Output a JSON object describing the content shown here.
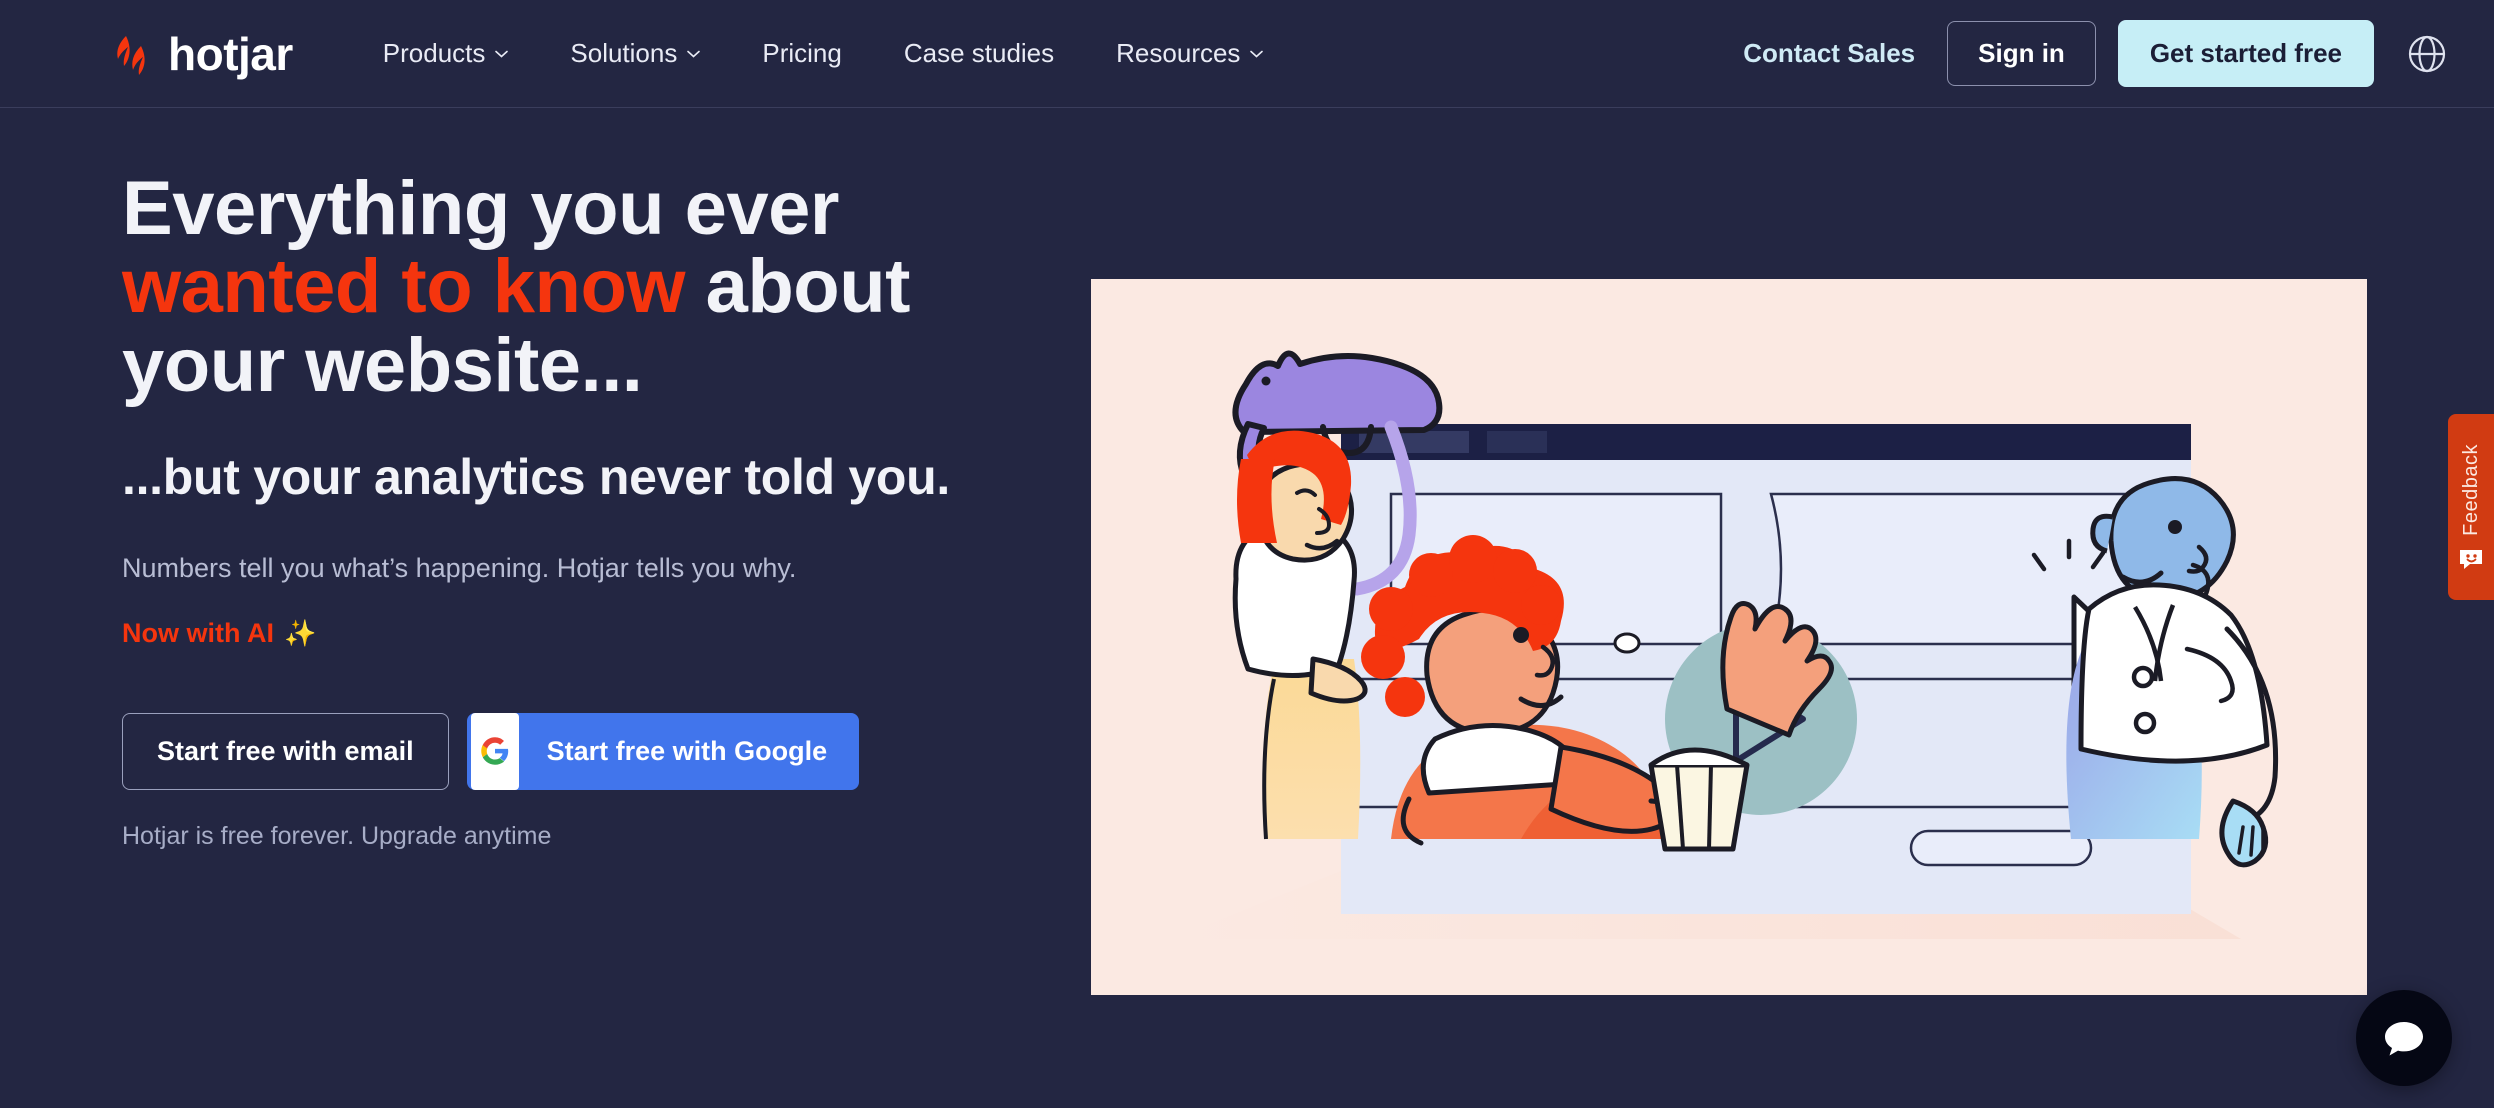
{
  "brand": {
    "name": "hotjar",
    "logo_icon": "hotjar-flame-logo",
    "accent_color": "#f5350e",
    "background_color": "#232642",
    "cta_color": "#c6eef6"
  },
  "header": {
    "nav_items": [
      {
        "label": "Products",
        "has_dropdown": true,
        "icon": "chevron-down-icon"
      },
      {
        "label": "Solutions",
        "has_dropdown": true,
        "icon": "chevron-down-icon"
      },
      {
        "label": "Pricing",
        "has_dropdown": false
      },
      {
        "label": "Case studies",
        "has_dropdown": false
      },
      {
        "label": "Resources",
        "has_dropdown": true,
        "icon": "chevron-down-icon"
      }
    ],
    "contact_sales_label": "Contact Sales",
    "sign_in_label": "Sign in",
    "get_started_label": "Get started free",
    "language_icon": "globe-icon"
  },
  "hero": {
    "headline_part1": "Everything you ever ",
    "headline_accent": "wanted to know",
    "headline_part2": " about your website...",
    "subheadline": "...but your analytics never told you.",
    "tagline": "Numbers tell you what’s happening. Hotjar tells you why.",
    "ai_badge_label": "Now with AI",
    "ai_badge_icon": "sparkles-icon",
    "sparkle_glyph": "✨",
    "cta_email_label": "Start free with email",
    "cta_google_label": "Start free with Google",
    "google_icon": "google-g-icon",
    "free_note": "Hotjar is free forever. Upgrade anytime"
  },
  "illustration": {
    "name": "hero-illustration-people-watching-website-video",
    "background_color": "#fbe9e2",
    "browser_bar_color": "#1c2045",
    "browser_body_color": "#e3e8f7",
    "play_circle_color": "#9cc0c4",
    "cat_color": "#9b86e0"
  },
  "feedback_widget": {
    "label": "Feedback",
    "icon": "feedback-smiley-icon",
    "color": "#d13b12"
  },
  "chat_widget": {
    "icon": "chat-bubble-icon",
    "color": "#050714"
  }
}
